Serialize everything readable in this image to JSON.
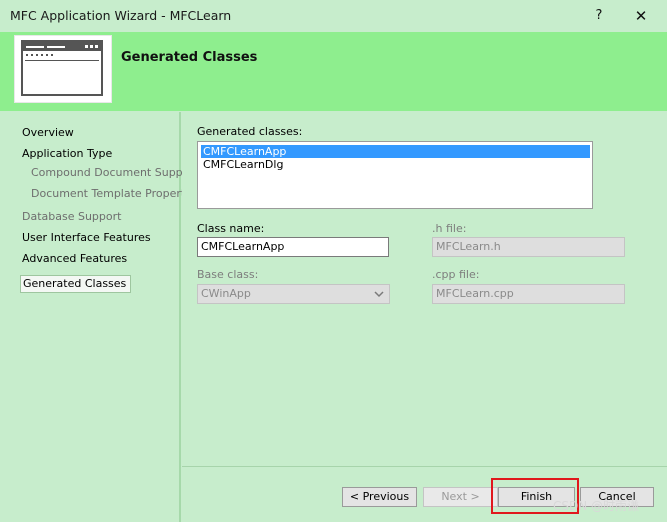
{
  "window": {
    "title": "MFC Application Wizard - MFCLearn",
    "help_glyph": "?",
    "close_glyph": "✕"
  },
  "header": {
    "heading": "Generated Classes"
  },
  "nav": {
    "items": [
      {
        "label": "Overview",
        "state": "enabled"
      },
      {
        "label": "Application Type",
        "state": "enabled"
      },
      {
        "label": "Compound Document Support",
        "state": "disabled"
      },
      {
        "label": "Document Template Properties",
        "state": "disabled"
      },
      {
        "label": "Database Support",
        "state": "disabled"
      },
      {
        "label": "User Interface Features",
        "state": "enabled"
      },
      {
        "label": "Advanced Features",
        "state": "enabled"
      },
      {
        "label": "Generated Classes",
        "state": "selected"
      }
    ]
  },
  "form": {
    "generated_classes_label": "Generated classes:",
    "classes": [
      {
        "name": "CMFCLearnApp",
        "selected": true
      },
      {
        "name": "CMFCLearnDlg",
        "selected": false
      }
    ],
    "class_name_label": "Class name:",
    "class_name_value": "CMFCLearnApp",
    "h_file_label": ".h file:",
    "h_file_value": "MFCLearn.h",
    "base_class_label": "Base class:",
    "base_class_value": "CWinApp",
    "cpp_file_label": ".cpp file:",
    "cpp_file_value": "MFCLearn.cpp"
  },
  "buttons": {
    "previous": "< Previous",
    "next": "Next >",
    "finish": "Finish",
    "cancel": "Cancel"
  },
  "watermark": "CSDN @时雨谦"
}
